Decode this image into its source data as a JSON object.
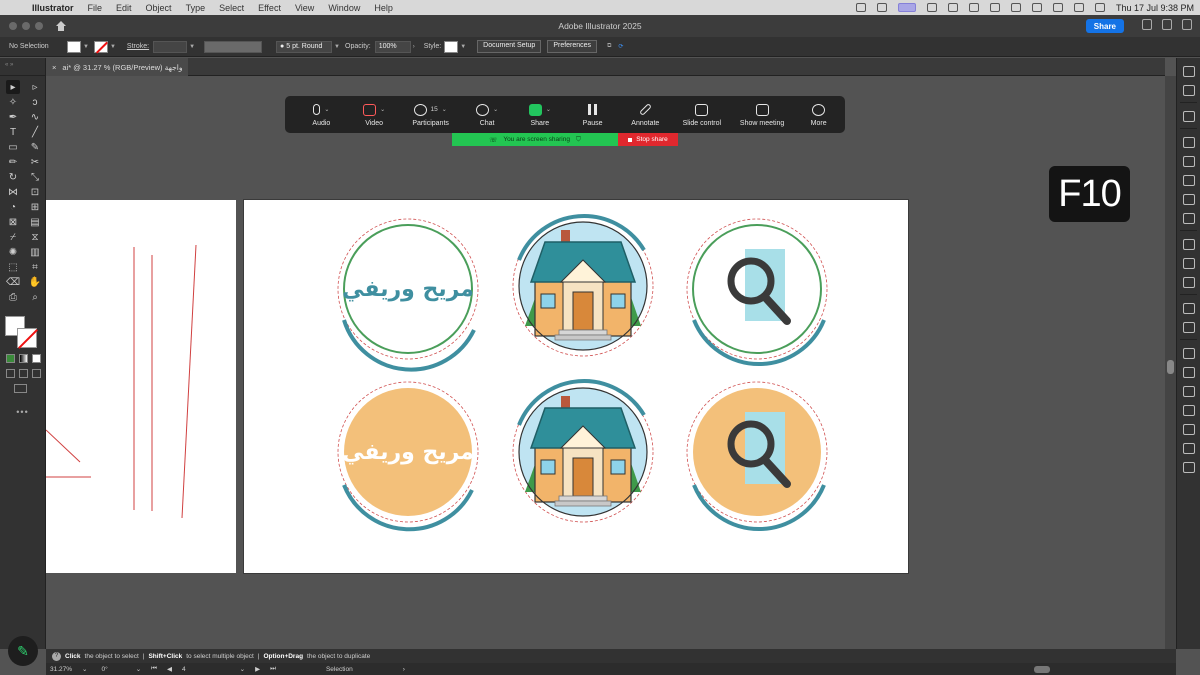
{
  "menubar": {
    "app_name": "Illustrator",
    "items": [
      "File",
      "Edit",
      "Object",
      "Type",
      "Select",
      "Effect",
      "View",
      "Window",
      "Help"
    ],
    "clock": "Thu 17 Jul 9:38 PM"
  },
  "window": {
    "title": "Adobe Illustrator 2025",
    "share_label": "Share"
  },
  "control_bar": {
    "selection": "No Selection",
    "stroke_label": "Stroke:",
    "brush_value": "5 pt. Round",
    "opacity_label": "Opacity:",
    "opacity_value": "100%",
    "style_label": "Style:",
    "document_setup": "Document Setup",
    "preferences": "Preferences"
  },
  "document_tab": {
    "title": "ai* @ 31.27 % (RGB/Preview) واجهة"
  },
  "zoom_toolbar": {
    "items": [
      {
        "label": "Audio",
        "icon": "microphone-icon"
      },
      {
        "label": "Video",
        "icon": "video-off-icon"
      },
      {
        "label": "Participants",
        "icon": "participants-icon",
        "count": "15"
      },
      {
        "label": "Chat",
        "icon": "chat-icon"
      },
      {
        "label": "Share",
        "icon": "share-screen-icon"
      },
      {
        "label": "Pause",
        "icon": "pause-icon"
      },
      {
        "label": "Annotate",
        "icon": "pen-icon"
      },
      {
        "label": "Slide control",
        "icon": "slide-control-icon"
      },
      {
        "label": "Show meeting",
        "icon": "show-meeting-icon"
      },
      {
        "label": "More",
        "icon": "more-icon"
      }
    ],
    "sharing_text": "You are screen sharing",
    "stop_share": "Stop share"
  },
  "key_overlay": "F10",
  "artwork": {
    "brand_text": "مريح وريفي",
    "colors": {
      "teal": "#3f8fa0",
      "green": "#4a9e5a",
      "orange": "#f3c07a",
      "red_dash": "#d05050"
    }
  },
  "hint_bar": {
    "click": "Click",
    "click_text": "the object to select",
    "shift_click": "Shift+Click",
    "shift_click_text": "to select multiple object",
    "option_drag": "Option+Drag",
    "option_drag_text": "the object to duplicate"
  },
  "status_bar": {
    "zoom": "31.27%",
    "rotation": "0°",
    "artboard": "4",
    "tool": "Selection"
  }
}
